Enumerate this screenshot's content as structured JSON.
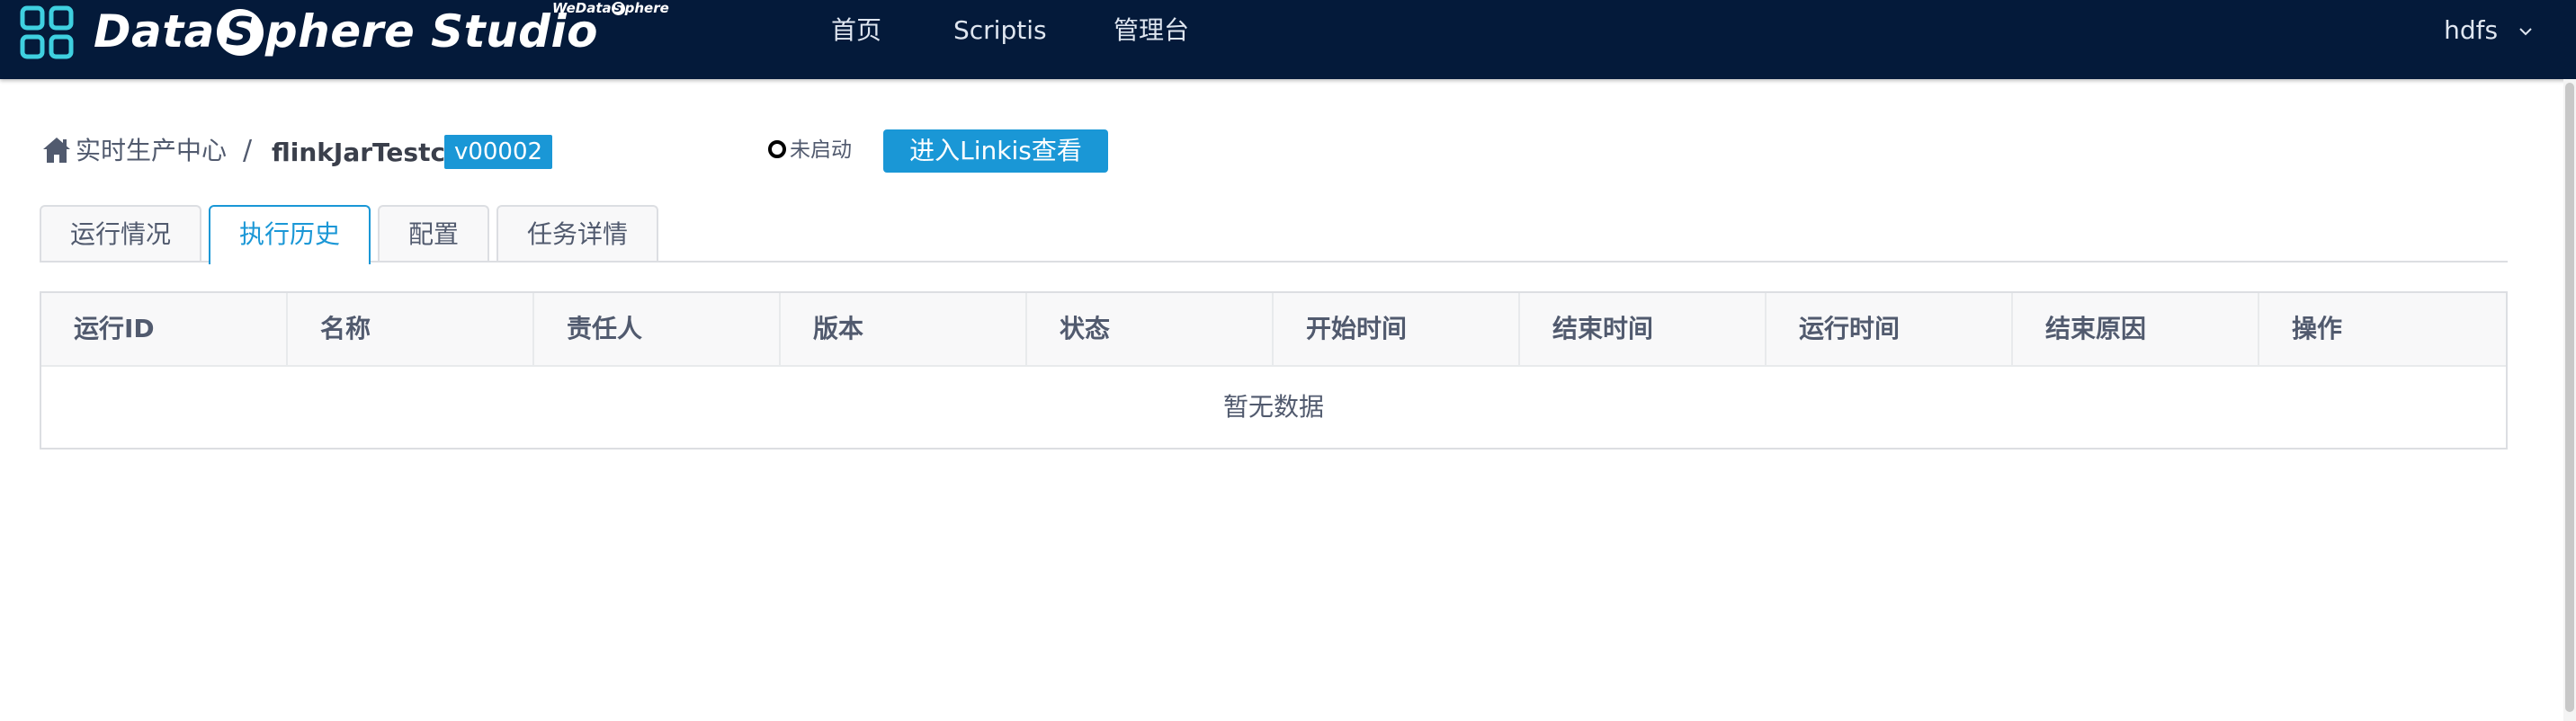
{
  "app": {
    "brand": {
      "before": "Data",
      "s": "S",
      "after": "phere Studio"
    },
    "sub_brand": {
      "before": "WeData",
      "s": "S",
      "after": "phere"
    }
  },
  "nav": {
    "items": [
      {
        "label": "首页"
      },
      {
        "label": "Scriptis"
      },
      {
        "label": "管理台"
      }
    ],
    "user": "hdfs"
  },
  "breadcrumb": {
    "root": "实时生产中心",
    "separator": "/",
    "job_name": "flinkJarTestc",
    "version": "v00002"
  },
  "status": {
    "text": "未启动"
  },
  "actions": {
    "linkis_button": "进入Linkis查看"
  },
  "tabs": [
    {
      "label": "运行情况",
      "active": false
    },
    {
      "label": "执行历史",
      "active": true
    },
    {
      "label": "配置",
      "active": false
    },
    {
      "label": "任务详情",
      "active": false
    }
  ],
  "table": {
    "columns": [
      "运行ID",
      "名称",
      "责任人",
      "版本",
      "状态",
      "开始时间",
      "结束时间",
      "运行时间",
      "结束原因",
      "操作"
    ],
    "empty_text": "暂无数据"
  },
  "colors": {
    "topbar": "#041a3a",
    "accent": "#1a97d6",
    "brand_icon": "#3fd0e0"
  },
  "icons": {
    "brand": "grid-logo-icon",
    "home": "home-icon",
    "user_caret": "chevron-down-icon",
    "status": "status-circle-icon"
  }
}
